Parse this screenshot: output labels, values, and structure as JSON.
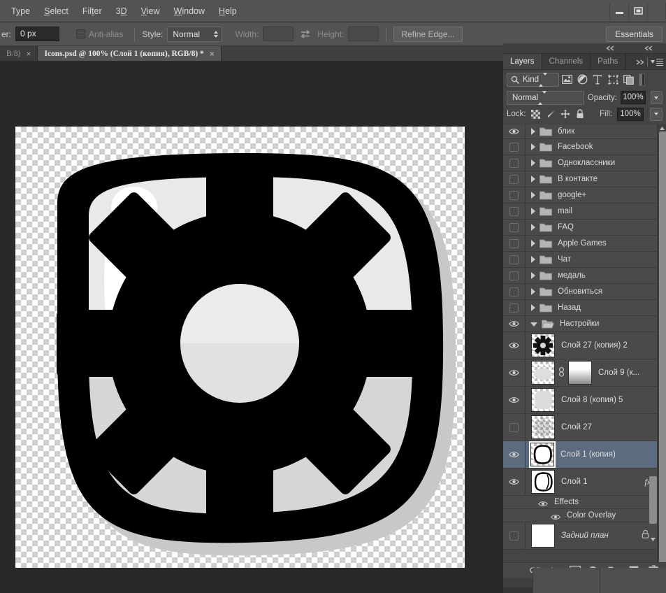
{
  "window": {
    "minimize_label": "minimize",
    "maximize_label": "maximize"
  },
  "menubar": {
    "items": [
      {
        "label": "Type",
        "mnemonic_index": 1
      },
      {
        "label": "Select",
        "mnemonic_index": 0
      },
      {
        "label": "Filter",
        "mnemonic_index": 3
      },
      {
        "label": "3D",
        "mnemonic_index": 1
      },
      {
        "label": "View",
        "mnemonic_index": 0
      },
      {
        "label": "Window",
        "mnemonic_index": 0
      },
      {
        "label": "Help",
        "mnemonic_index": 0
      }
    ]
  },
  "options_bar": {
    "feather_label": "er:",
    "feather_value": "0 px",
    "antialias_label": "Anti-alias",
    "antialias_checked": false,
    "style_label": "Style:",
    "style_value": "Normal",
    "width_label": "Width:",
    "width_value": "",
    "swap_icon": "swap-arrows-icon",
    "height_label": "Height:",
    "height_value": "",
    "refine_edge_label": "Refine Edge...",
    "workspace_label": "Essentials"
  },
  "tabs": [
    {
      "label": "B/8)",
      "active": false,
      "close": "×"
    },
    {
      "label": "Icons.psd @ 100% (Слой 1  (копия), RGB/8) *",
      "active": true,
      "close": "×"
    }
  ],
  "canvas": {
    "document_name": "Icons.psd",
    "zoom": "100%",
    "artwork": "settings-gear-icon-rounded-square",
    "colors": {
      "outline": "#000000",
      "face_light": "#eaeaea",
      "face_shadow": "#d3d3d3",
      "highlight": "#ffffff",
      "drop_shadow": "#c8c8c8"
    }
  },
  "panel": {
    "collapse_left_icon": "double-chevron-left-icon",
    "tabs": [
      {
        "label": "Layers",
        "active": true
      },
      {
        "label": "Channels",
        "active": false
      },
      {
        "label": "Paths",
        "active": false
      }
    ],
    "expand_icon": "double-chevron-right-icon",
    "menu_icon": "panel-menu-icon",
    "filter": {
      "kind_label": "Kind",
      "icons": [
        "pixel-layer-filter-icon",
        "adjustment-layer-filter-icon",
        "type-layer-filter-icon",
        "shape-layer-filter-icon",
        "smart-object-filter-icon"
      ],
      "toggle_icon": "filter-toggle-switch"
    },
    "blend_mode": "Normal",
    "opacity_label": "Opacity:",
    "opacity_value": "100%",
    "lock_label": "Lock:",
    "lock_icons": [
      "lock-transparent-pixels-icon",
      "lock-image-pixels-icon",
      "lock-position-icon",
      "lock-all-icon"
    ],
    "fill_label": "Fill:",
    "fill_value": "100%",
    "footer_icons": [
      "link-layers-icon",
      "add-layer-style-fx-icon",
      "add-layer-mask-icon",
      "new-adjustment-layer-icon",
      "new-group-icon",
      "new-layer-icon",
      "delete-layer-icon"
    ]
  },
  "layers": [
    {
      "name": "блик",
      "type": "group",
      "visible": true,
      "expanded": false,
      "indent": 0,
      "partial_top": true
    },
    {
      "name": "Facebook",
      "type": "group",
      "visible": false,
      "expanded": false,
      "indent": 0
    },
    {
      "name": "Одноклассники",
      "type": "group",
      "visible": false,
      "expanded": false,
      "indent": 0
    },
    {
      "name": "В контакте",
      "type": "group",
      "visible": false,
      "expanded": false,
      "indent": 0
    },
    {
      "name": "google+",
      "type": "group",
      "visible": false,
      "expanded": false,
      "indent": 0
    },
    {
      "name": "mail",
      "type": "group",
      "visible": false,
      "expanded": false,
      "indent": 0
    },
    {
      "name": "FAQ",
      "type": "group",
      "visible": false,
      "expanded": false,
      "indent": 0
    },
    {
      "name": "Apple Games",
      "type": "group",
      "visible": false,
      "expanded": false,
      "indent": 0
    },
    {
      "name": "Чат",
      "type": "group",
      "visible": false,
      "expanded": false,
      "indent": 0
    },
    {
      "name": "медаль",
      "type": "group",
      "visible": false,
      "expanded": false,
      "indent": 0
    },
    {
      "name": "Обновиться",
      "type": "group",
      "visible": false,
      "expanded": false,
      "indent": 0
    },
    {
      "name": "Назад",
      "type": "group",
      "visible": false,
      "expanded": false,
      "indent": 0
    },
    {
      "name": "Настройки",
      "type": "group",
      "visible": true,
      "expanded": true,
      "indent": 0
    },
    {
      "name": "Слой 27 (копия) 2",
      "type": "layer",
      "visible": true,
      "thumb": "gear-black",
      "indent": 1
    },
    {
      "name": "Слой 9 (к...",
      "type": "layer",
      "visible": true,
      "thumb": "soft-blob",
      "mask": "gradient-mask",
      "linked": true,
      "indent": 1
    },
    {
      "name": "Слой 8 (копия) 5",
      "type": "layer",
      "visible": true,
      "thumb": "rounded-square-light",
      "indent": 1
    },
    {
      "name": "Слой 27",
      "type": "layer",
      "visible": false,
      "thumb": "gear-faint",
      "indent": 1
    },
    {
      "name": "Слой 1 (копия)",
      "type": "layer",
      "visible": true,
      "thumb": "outline-square",
      "selected": true,
      "indent": 1
    },
    {
      "name": "Слой 1",
      "type": "layer",
      "visible": true,
      "thumb": "outline-square-2",
      "fx": "fx",
      "indent": 1
    },
    {
      "name": "Effects",
      "type": "effects-header",
      "visible": true,
      "indent": 2
    },
    {
      "name": "Color Overlay",
      "type": "effect",
      "visible": true,
      "indent": 3
    },
    {
      "name": "Задний план",
      "type": "layer",
      "visible": false,
      "thumb": "white",
      "locked": true,
      "italic": true,
      "indent": 0
    }
  ]
}
